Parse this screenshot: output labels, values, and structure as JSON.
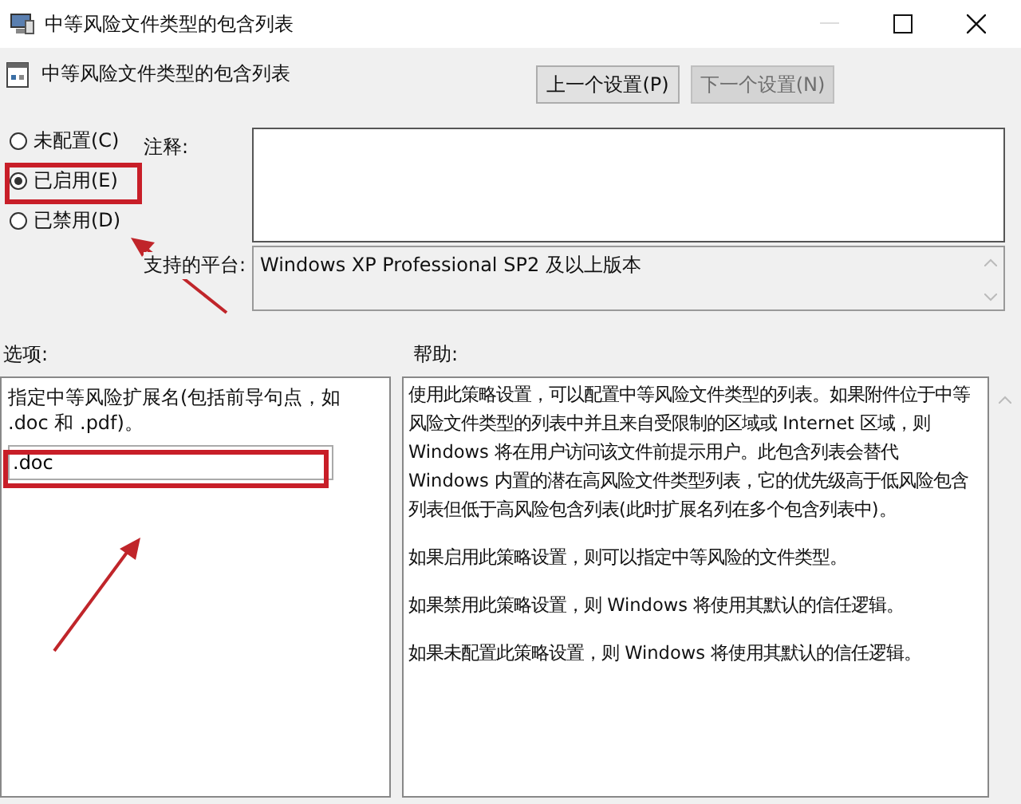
{
  "window": {
    "title": "中等风险文件类型的包含列表"
  },
  "header": {
    "title": "中等风险文件类型的包含列表"
  },
  "nav_buttons": [
    {
      "label": "上一个设置(P)",
      "disabled": false
    },
    {
      "label": "下一个设置(N)",
      "disabled": true
    }
  ],
  "state_options": [
    {
      "label": "未配置(C)",
      "selected": false
    },
    {
      "label": "已启用(E)",
      "selected": true
    },
    {
      "label": "已禁用(D)",
      "selected": false
    }
  ],
  "comment": {
    "label": "注释:"
  },
  "platform": {
    "label": "支持的平台:",
    "value": "Windows XP Professional SP2 及以上版本"
  },
  "options": {
    "label": "选项:",
    "description": "指定中等风险扩展名(包括前导句点，如  .doc 和 .pdf)。",
    "value": ".doc"
  },
  "help": {
    "label": "帮助:",
    "paragraphs": [
      "使用此策略设置，可以配置中等风险文件类型的列表。如果附件位于中等风险文件类型的列表中并且来自受限制的区域或 Internet 区域，则 Windows 将在用户访问该文件前提示用户。此包含列表会替代 Windows 内置的潜在高风险文件类型列表，它的优先级高于低风险包含列表但低于高风险包含列表(此时扩展名列在多个包含列表中)。",
      "如果启用此策略设置，则可以指定中等风险的文件类型。",
      "如果禁用此策略设置，则 Windows 将使用其默认的信任逻辑。",
      "如果未配置此策略设置，则 Windows 将使用其默认的信任逻辑。"
    ]
  }
}
